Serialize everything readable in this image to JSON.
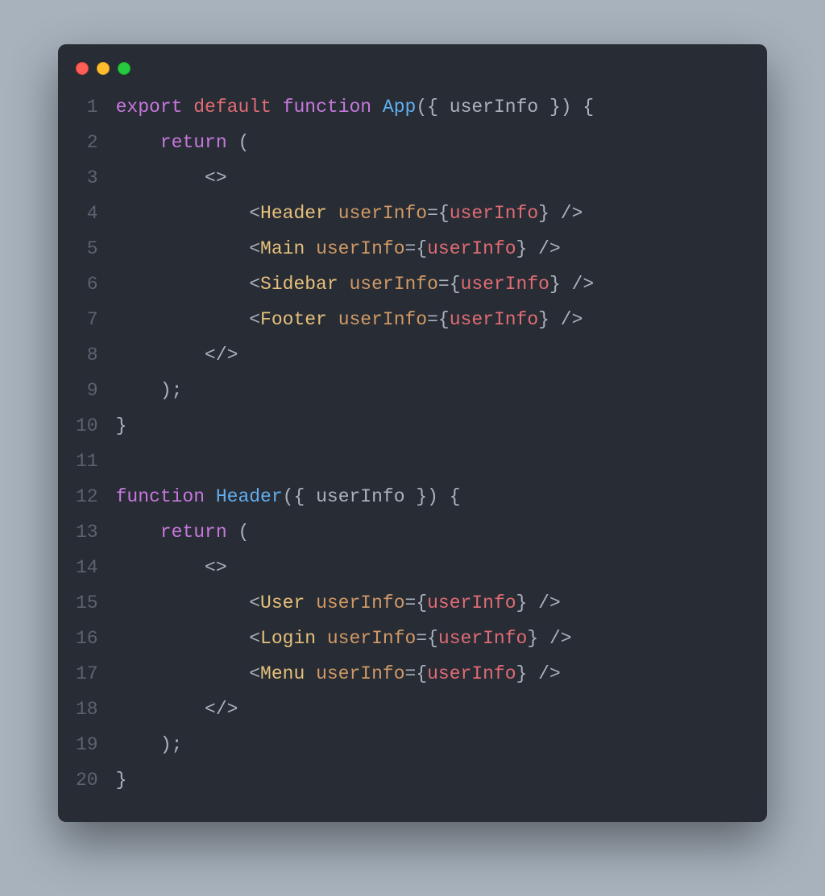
{
  "window": {
    "traffic_lights": [
      "red",
      "yellow",
      "green"
    ]
  },
  "syntax": {
    "kw": "#c678dd",
    "ty": "#e06c75",
    "fn": "#61afef",
    "cmp": "#e5c07b",
    "attr": "#d19a66",
    "expr": "#e06c75",
    "punc": "#abb2bf"
  },
  "code": {
    "lines": [
      {
        "num": 1,
        "tokens": [
          [
            "kw",
            "export"
          ],
          [
            "punc",
            " "
          ],
          [
            "ty",
            "default"
          ],
          [
            "punc",
            " "
          ],
          [
            "kw",
            "function"
          ],
          [
            "punc",
            " "
          ],
          [
            "fn",
            "App"
          ],
          [
            "punc",
            "({ "
          ],
          [
            "ident",
            "userInfo"
          ],
          [
            "punc",
            " }) {"
          ]
        ]
      },
      {
        "num": 2,
        "tokens": [
          [
            "punc",
            "    "
          ],
          [
            "kw",
            "return"
          ],
          [
            "punc",
            " ("
          ]
        ]
      },
      {
        "num": 3,
        "tokens": [
          [
            "punc",
            "        <>"
          ]
        ]
      },
      {
        "num": 4,
        "tokens": [
          [
            "punc",
            "            <"
          ],
          [
            "cmp",
            "Header"
          ],
          [
            "punc",
            " "
          ],
          [
            "attr",
            "userInfo"
          ],
          [
            "punc",
            "="
          ],
          [
            "punc",
            "{"
          ],
          [
            "expr",
            "userInfo"
          ],
          [
            "punc",
            "}"
          ],
          [
            "punc",
            " />"
          ]
        ]
      },
      {
        "num": 5,
        "tokens": [
          [
            "punc",
            "            <"
          ],
          [
            "cmp",
            "Main"
          ],
          [
            "punc",
            " "
          ],
          [
            "attr",
            "userInfo"
          ],
          [
            "punc",
            "="
          ],
          [
            "punc",
            "{"
          ],
          [
            "expr",
            "userInfo"
          ],
          [
            "punc",
            "}"
          ],
          [
            "punc",
            " />"
          ]
        ]
      },
      {
        "num": 6,
        "tokens": [
          [
            "punc",
            "            <"
          ],
          [
            "cmp",
            "Sidebar"
          ],
          [
            "punc",
            " "
          ],
          [
            "attr",
            "userInfo"
          ],
          [
            "punc",
            "="
          ],
          [
            "punc",
            "{"
          ],
          [
            "expr",
            "userInfo"
          ],
          [
            "punc",
            "}"
          ],
          [
            "punc",
            " />"
          ]
        ]
      },
      {
        "num": 7,
        "tokens": [
          [
            "punc",
            "            <"
          ],
          [
            "cmp",
            "Footer"
          ],
          [
            "punc",
            " "
          ],
          [
            "attr",
            "userInfo"
          ],
          [
            "punc",
            "="
          ],
          [
            "punc",
            "{"
          ],
          [
            "expr",
            "userInfo"
          ],
          [
            "punc",
            "}"
          ],
          [
            "punc",
            " />"
          ]
        ]
      },
      {
        "num": 8,
        "tokens": [
          [
            "punc",
            "        </>"
          ]
        ]
      },
      {
        "num": 9,
        "tokens": [
          [
            "punc",
            "    );"
          ]
        ]
      },
      {
        "num": 10,
        "tokens": [
          [
            "punc",
            "}"
          ]
        ]
      },
      {
        "num": 11,
        "tokens": [
          [
            "punc",
            ""
          ]
        ]
      },
      {
        "num": 12,
        "tokens": [
          [
            "kw",
            "function"
          ],
          [
            "punc",
            " "
          ],
          [
            "fn",
            "Header"
          ],
          [
            "punc",
            "({ "
          ],
          [
            "ident",
            "userInfo"
          ],
          [
            "punc",
            " }) {"
          ]
        ]
      },
      {
        "num": 13,
        "tokens": [
          [
            "punc",
            "    "
          ],
          [
            "kw",
            "return"
          ],
          [
            "punc",
            " ("
          ]
        ]
      },
      {
        "num": 14,
        "tokens": [
          [
            "punc",
            "        <>"
          ]
        ]
      },
      {
        "num": 15,
        "tokens": [
          [
            "punc",
            "            <"
          ],
          [
            "cmp",
            "User"
          ],
          [
            "punc",
            " "
          ],
          [
            "attr",
            "userInfo"
          ],
          [
            "punc",
            "="
          ],
          [
            "punc",
            "{"
          ],
          [
            "expr",
            "userInfo"
          ],
          [
            "punc",
            "}"
          ],
          [
            "punc",
            " />"
          ]
        ]
      },
      {
        "num": 16,
        "tokens": [
          [
            "punc",
            "            <"
          ],
          [
            "cmp",
            "Login"
          ],
          [
            "punc",
            " "
          ],
          [
            "attr",
            "userInfo"
          ],
          [
            "punc",
            "="
          ],
          [
            "punc",
            "{"
          ],
          [
            "expr",
            "userInfo"
          ],
          [
            "punc",
            "}"
          ],
          [
            "punc",
            " />"
          ]
        ]
      },
      {
        "num": 17,
        "tokens": [
          [
            "punc",
            "            <"
          ],
          [
            "cmp",
            "Menu"
          ],
          [
            "punc",
            " "
          ],
          [
            "attr",
            "userInfo"
          ],
          [
            "punc",
            "="
          ],
          [
            "punc",
            "{"
          ],
          [
            "expr",
            "userInfo"
          ],
          [
            "punc",
            "}"
          ],
          [
            "punc",
            " />"
          ]
        ]
      },
      {
        "num": 18,
        "tokens": [
          [
            "punc",
            "        </>"
          ]
        ]
      },
      {
        "num": 19,
        "tokens": [
          [
            "punc",
            "    );"
          ]
        ]
      },
      {
        "num": 20,
        "tokens": [
          [
            "punc",
            "}"
          ]
        ]
      }
    ]
  }
}
